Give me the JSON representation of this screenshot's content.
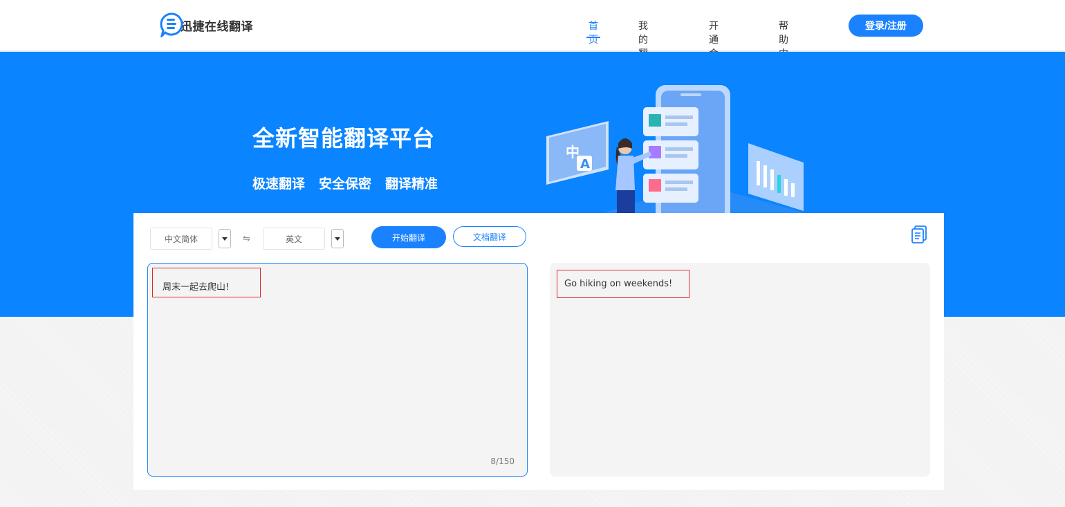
{
  "header": {
    "logo_text": "迅捷在线翻译",
    "nav": [
      {
        "label": "首页",
        "active": true
      },
      {
        "label": "我的翻译",
        "active": false
      },
      {
        "label": "开通会员",
        "active": false
      },
      {
        "label": "帮助中心",
        "active": false
      }
    ],
    "login_label": "登录/注册"
  },
  "hero": {
    "title": "全新智能翻译平台",
    "features": [
      "极速翻译",
      "安全保密",
      "翻译精准"
    ],
    "illustration_chars": {
      "zh": "中",
      "en": "A"
    }
  },
  "translator": {
    "source_lang": "中文简体",
    "swap_symbol": "⇋",
    "target_lang": "英文",
    "start_label": "开始翻译",
    "doc_label": "文档翻译",
    "source_text": "周末一起去爬山!",
    "char_count": "8/150",
    "result_text": "Go hiking on weekends!"
  },
  "colors": {
    "accent": "#1a82ff",
    "hero_bg": "#0a84ff",
    "highlight_border": "#d82a2a"
  },
  "icons": {
    "logo": "chat-bubble-lines-icon",
    "dropdown": "caret-down-icon",
    "swap": "swap-arrows-icon",
    "copy": "copy-icon"
  }
}
